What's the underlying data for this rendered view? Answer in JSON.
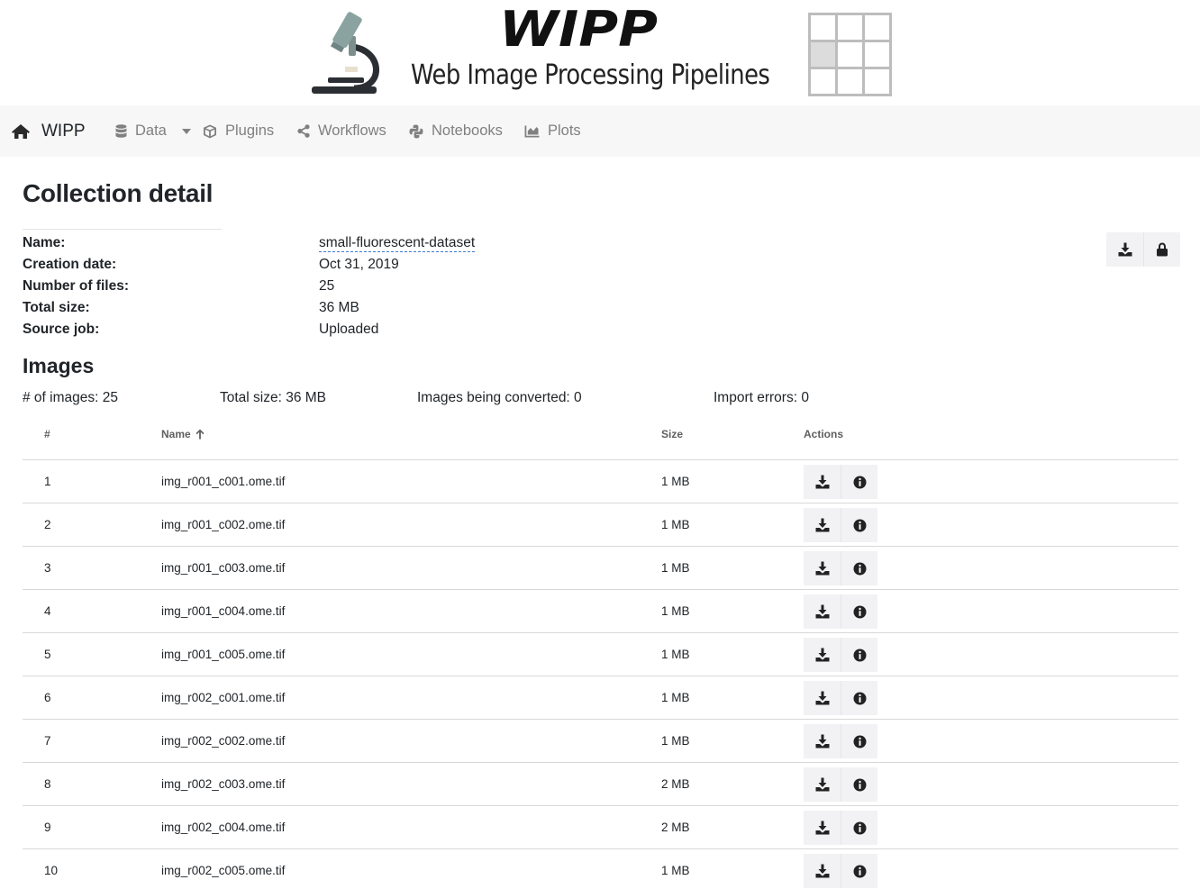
{
  "banner": {
    "logo_wordmark": "WIPP",
    "subtitle": "Web Image Processing Pipelines",
    "icons": [
      "microscope-icon",
      "grid-icon"
    ]
  },
  "navbar": {
    "brand": "WIPP",
    "brand_icon": "home-icon",
    "items": [
      {
        "label": "Data",
        "icon": "database-icon",
        "dropdown": true
      },
      {
        "label": "Plugins",
        "icon": "cube-icon"
      },
      {
        "label": "Workflows",
        "icon": "share-icon"
      },
      {
        "label": "Notebooks",
        "icon": "python-icon"
      },
      {
        "label": "Plots",
        "icon": "area-chart-icon"
      }
    ]
  },
  "collection": {
    "title": "Collection detail",
    "fields": [
      {
        "label": "Name:",
        "value": "small-fluorescent-dataset"
      },
      {
        "label": "Creation date:",
        "value": "Oct 31, 2019"
      },
      {
        "label": "Number of files:",
        "value": "25"
      },
      {
        "label": "Total size:",
        "value": "36 MB"
      },
      {
        "label": "Source job:",
        "value": "Uploaded"
      }
    ],
    "actions": [
      "download-icon",
      "lock-icon"
    ]
  },
  "images": {
    "title": "Images",
    "stats": [
      "# of images: 25",
      "Total size: 36 MB",
      "Images being converted: 0",
      "Import errors: 0"
    ],
    "columns": {
      "index": "#",
      "name": "Name",
      "size": "Size",
      "actions": "Actions"
    },
    "sort": {
      "column": "Name",
      "direction": "ascending"
    },
    "rows": [
      {
        "index": "1",
        "name": "img_r001_c001.ome.tif",
        "size": "1 MB"
      },
      {
        "index": "2",
        "name": "img_r001_c002.ome.tif",
        "size": "1 MB"
      },
      {
        "index": "3",
        "name": "img_r001_c003.ome.tif",
        "size": "1 MB"
      },
      {
        "index": "4",
        "name": "img_r001_c004.ome.tif",
        "size": "1 MB"
      },
      {
        "index": "5",
        "name": "img_r001_c005.ome.tif",
        "size": "1 MB"
      },
      {
        "index": "6",
        "name": "img_r002_c001.ome.tif",
        "size": "1 MB"
      },
      {
        "index": "7",
        "name": "img_r002_c002.ome.tif",
        "size": "1 MB"
      },
      {
        "index": "8",
        "name": "img_r002_c003.ome.tif",
        "size": "2 MB"
      },
      {
        "index": "9",
        "name": "img_r002_c004.ome.tif",
        "size": "2 MB"
      },
      {
        "index": "10",
        "name": "img_r002_c005.ome.tif",
        "size": "1 MB"
      }
    ],
    "row_actions": [
      "download-icon",
      "info-icon"
    ]
  },
  "colors": {
    "navbar_bg": "#f7f7f8",
    "nav_text": "#808080",
    "text": "#212529",
    "button_bg": "#f2f2f4",
    "name_underline": "#3c7bd0",
    "grid_highlight": "#dcdcdc"
  }
}
